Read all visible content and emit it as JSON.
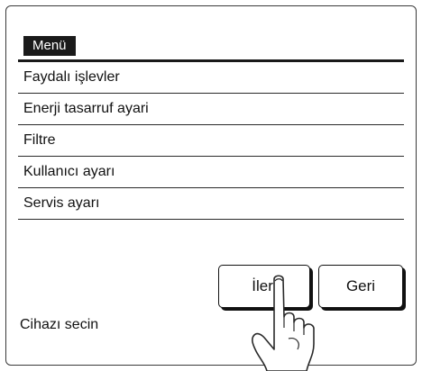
{
  "menu": {
    "title": "Menü",
    "items": [
      {
        "label": "Faydalı işlevler"
      },
      {
        "label": "Enerji tasarruf ayari"
      },
      {
        "label": "Filtre"
      },
      {
        "label": "Kullanıcı ayarı"
      },
      {
        "label": "Servis ayarı"
      }
    ]
  },
  "buttons": {
    "next_label": "İleri",
    "back_label": "Geri"
  },
  "status": {
    "text": "Cihazı secin"
  },
  "icons": {
    "pointer": "pointing-hand-icon"
  }
}
